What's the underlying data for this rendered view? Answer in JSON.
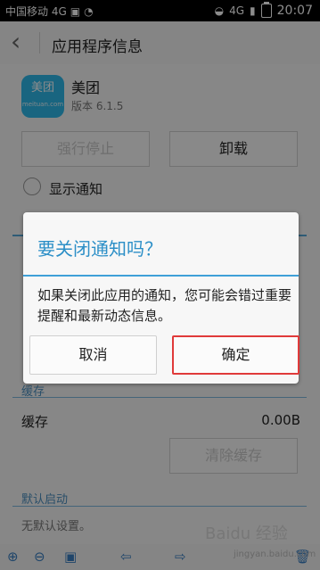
{
  "status_bar": {
    "carrier": "中国移动 4G",
    "network": "4G",
    "time": "20:07"
  },
  "header": {
    "title": "应用程序信息"
  },
  "app": {
    "icon_text_top": "美团",
    "icon_text_bottom": "meituan.com",
    "name": "美团",
    "version": "版本 6.1.5"
  },
  "buttons": {
    "force_stop": "强行停止",
    "uninstall": "卸载",
    "clear_cache": "清除缓存"
  },
  "notifications": {
    "label": "显示通知",
    "checked": false
  },
  "cache": {
    "section_title": "缓存",
    "label": "缓存",
    "value": "0.00B"
  },
  "default_launch": {
    "section_title": "默认启动",
    "value": "无默认设置。"
  },
  "watermark": {
    "brand": "Baidu 经验",
    "url": "jingyan.baidu.com"
  },
  "dialog": {
    "title": "要关闭通知吗？",
    "message": "如果关闭此应用的通知，您可能会错过重要提醒和最新动态信息。",
    "cancel": "取消",
    "confirm": "确定"
  }
}
